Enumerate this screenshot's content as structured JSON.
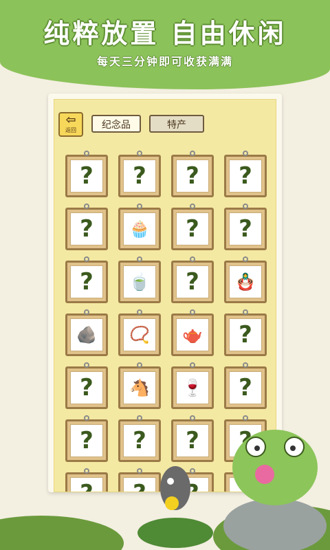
{
  "banner": {
    "title": "纯粹放置 自由休闲",
    "subtitle": "每天三分钟即可收获满满"
  },
  "toolbar": {
    "back_label": "返回",
    "tabs": [
      "纪念品",
      "特产"
    ]
  },
  "grid": {
    "unknown_symbol": "?",
    "items": [
      {
        "type": "unknown"
      },
      {
        "type": "unknown"
      },
      {
        "type": "unknown"
      },
      {
        "type": "unknown"
      },
      {
        "type": "unknown"
      },
      {
        "type": "item",
        "icon": "cake-figure-icon",
        "glyph": "🧁"
      },
      {
        "type": "unknown"
      },
      {
        "type": "unknown"
      },
      {
        "type": "unknown"
      },
      {
        "type": "item",
        "icon": "green-tea-bowl-icon",
        "glyph": "🍵"
      },
      {
        "type": "unknown"
      },
      {
        "type": "item",
        "icon": "matryoshka-doll-icon",
        "glyph": "🪆"
      },
      {
        "type": "item",
        "icon": "stone-specimen-icon",
        "glyph": "🪨"
      },
      {
        "type": "item",
        "icon": "prayer-beads-icon",
        "glyph": "📿"
      },
      {
        "type": "item",
        "icon": "iron-kettle-icon",
        "glyph": "🫖"
      },
      {
        "type": "unknown"
      },
      {
        "type": "unknown"
      },
      {
        "type": "item",
        "icon": "horse-figure-icon",
        "glyph": "🐴"
      },
      {
        "type": "item",
        "icon": "jade-goblet-icon",
        "glyph": "🍷"
      },
      {
        "type": "unknown"
      },
      {
        "type": "unknown"
      },
      {
        "type": "unknown"
      },
      {
        "type": "unknown"
      },
      {
        "type": "unknown"
      },
      {
        "type": "unknown"
      },
      {
        "type": "unknown"
      },
      {
        "type": "unknown"
      },
      {
        "type": "unknown"
      }
    ]
  },
  "colors": {
    "banner": "#8cc25a",
    "panel": "#f4e9a3",
    "frame": "#9a7a47",
    "question": "#3b5a1e"
  }
}
